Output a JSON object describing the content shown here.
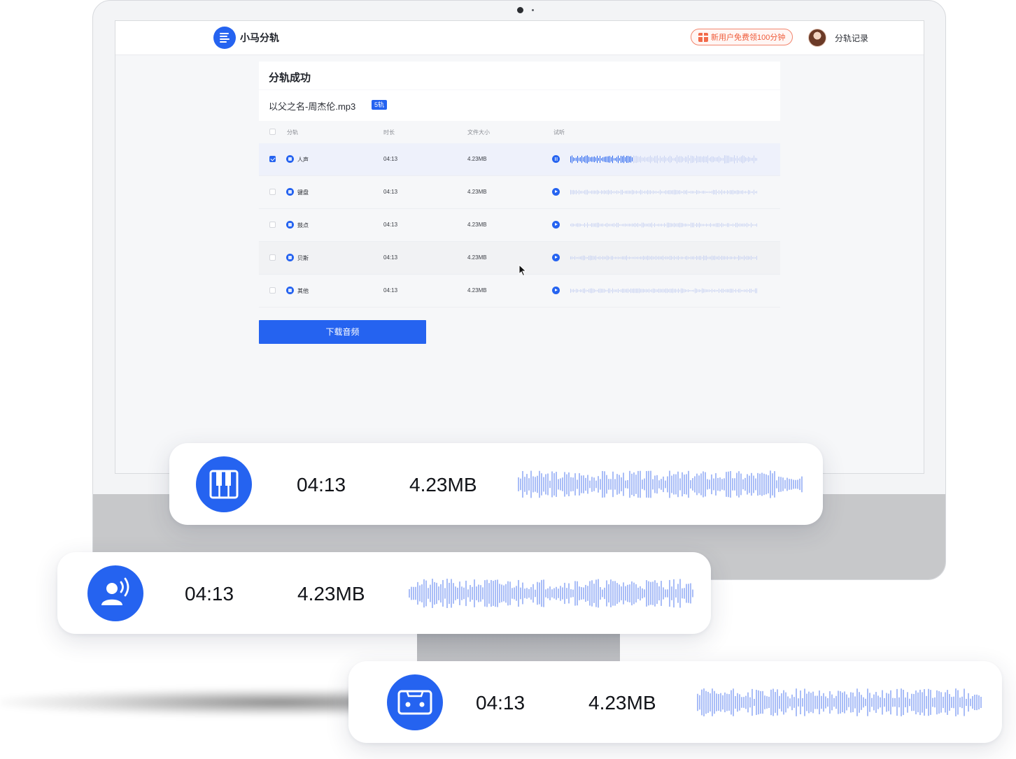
{
  "app": {
    "brand": "小马分轨",
    "promo": "新用户免费领100分钟",
    "records": "分轨记录"
  },
  "result": {
    "title": "分轨成功",
    "file_name": "以父之名-周杰伦.mp3",
    "track_count": "5轨",
    "columns": [
      "分轨",
      "时长",
      "文件大小",
      "试听"
    ],
    "tracks": [
      {
        "name": "人声",
        "duration": "04:13",
        "size": "4.23MB",
        "checked": true,
        "playing": true,
        "icon": "vocal-icon"
      },
      {
        "name": "键盘",
        "duration": "04:13",
        "size": "4.23MB",
        "checked": false,
        "playing": false,
        "icon": "keyboard-icon"
      },
      {
        "name": "鼓点",
        "duration": "04:13",
        "size": "4.23MB",
        "checked": false,
        "playing": false,
        "icon": "drum-icon"
      },
      {
        "name": "贝斯",
        "duration": "04:13",
        "size": "4.23MB",
        "checked": false,
        "playing": false,
        "icon": "bass-icon"
      },
      {
        "name": "其他",
        "duration": "04:13",
        "size": "4.23MB",
        "checked": false,
        "playing": false,
        "icon": "other-icon"
      }
    ],
    "download_label": "下载音频"
  },
  "cards": [
    {
      "icon": "piano-keys-icon",
      "duration": "04:13",
      "size": "4.23MB"
    },
    {
      "icon": "singer-icon",
      "duration": "04:13",
      "size": "4.23MB"
    },
    {
      "icon": "cassette-icon",
      "duration": "04:13",
      "size": "4.23MB"
    }
  ],
  "colors": {
    "accent": "#2563f0",
    "wave": "#a9bdf7",
    "promo": "#ef5b3a"
  }
}
